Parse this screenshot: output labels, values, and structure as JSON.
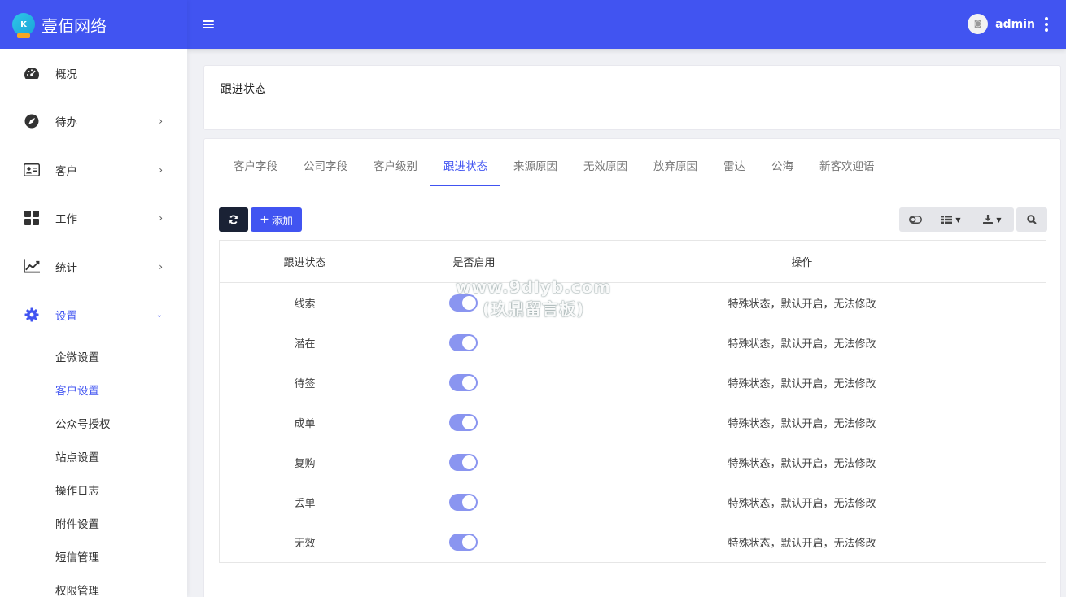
{
  "brand": {
    "name": "壹佰网络",
    "logo_text": "K"
  },
  "topbar": {
    "username": "admin"
  },
  "sidebar": {
    "items": [
      {
        "label": "概况",
        "icon": "dashboard-icon",
        "has_arrow": false
      },
      {
        "label": "待办",
        "icon": "compass-icon",
        "has_arrow": true
      },
      {
        "label": "客户",
        "icon": "id-card-icon",
        "has_arrow": true
      },
      {
        "label": "工作",
        "icon": "grid-icon",
        "has_arrow": true
      },
      {
        "label": "统计",
        "icon": "chart-line-icon",
        "has_arrow": true
      },
      {
        "label": "设置",
        "icon": "gear-icon",
        "has_arrow": true,
        "expanded": true
      }
    ],
    "sub_items": [
      "企微设置",
      "客户设置",
      "公众号授权",
      "站点设置",
      "操作日志",
      "附件设置",
      "短信管理",
      "权限管理"
    ],
    "active_sub_index": 1
  },
  "page": {
    "title": "跟进状态"
  },
  "tabs": [
    "客户字段",
    "公司字段",
    "客户级别",
    "跟进状态",
    "来源原因",
    "无效原因",
    "放弃原因",
    "雷达",
    "公海",
    "新客欢迎语"
  ],
  "active_tab_index": 3,
  "toolbar": {
    "add_label": "添加"
  },
  "table": {
    "headers": [
      "跟进状态",
      "是否启用",
      "操作"
    ],
    "rows": [
      {
        "status": "线索",
        "enabled": true,
        "action": "特殊状态，默认开启，无法修改"
      },
      {
        "status": "潜在",
        "enabled": true,
        "action": "特殊状态，默认开启，无法修改"
      },
      {
        "status": "待签",
        "enabled": true,
        "action": "特殊状态，默认开启，无法修改"
      },
      {
        "status": "成单",
        "enabled": true,
        "action": "特殊状态，默认开启，无法修改"
      },
      {
        "status": "复购",
        "enabled": true,
        "action": "特殊状态，默认开启，无法修改"
      },
      {
        "status": "丢单",
        "enabled": true,
        "action": "特殊状态，默认开启，无法修改"
      },
      {
        "status": "无效",
        "enabled": true,
        "action": "特殊状态，默认开启，无法修改"
      }
    ]
  },
  "watermark": {
    "line1": "www.9dlyb.com",
    "line2": "(玖鼎留言板)"
  },
  "colors": {
    "primary": "#4154f1",
    "dark_button": "#1a2235",
    "toggle_on": "#8a95f0"
  }
}
